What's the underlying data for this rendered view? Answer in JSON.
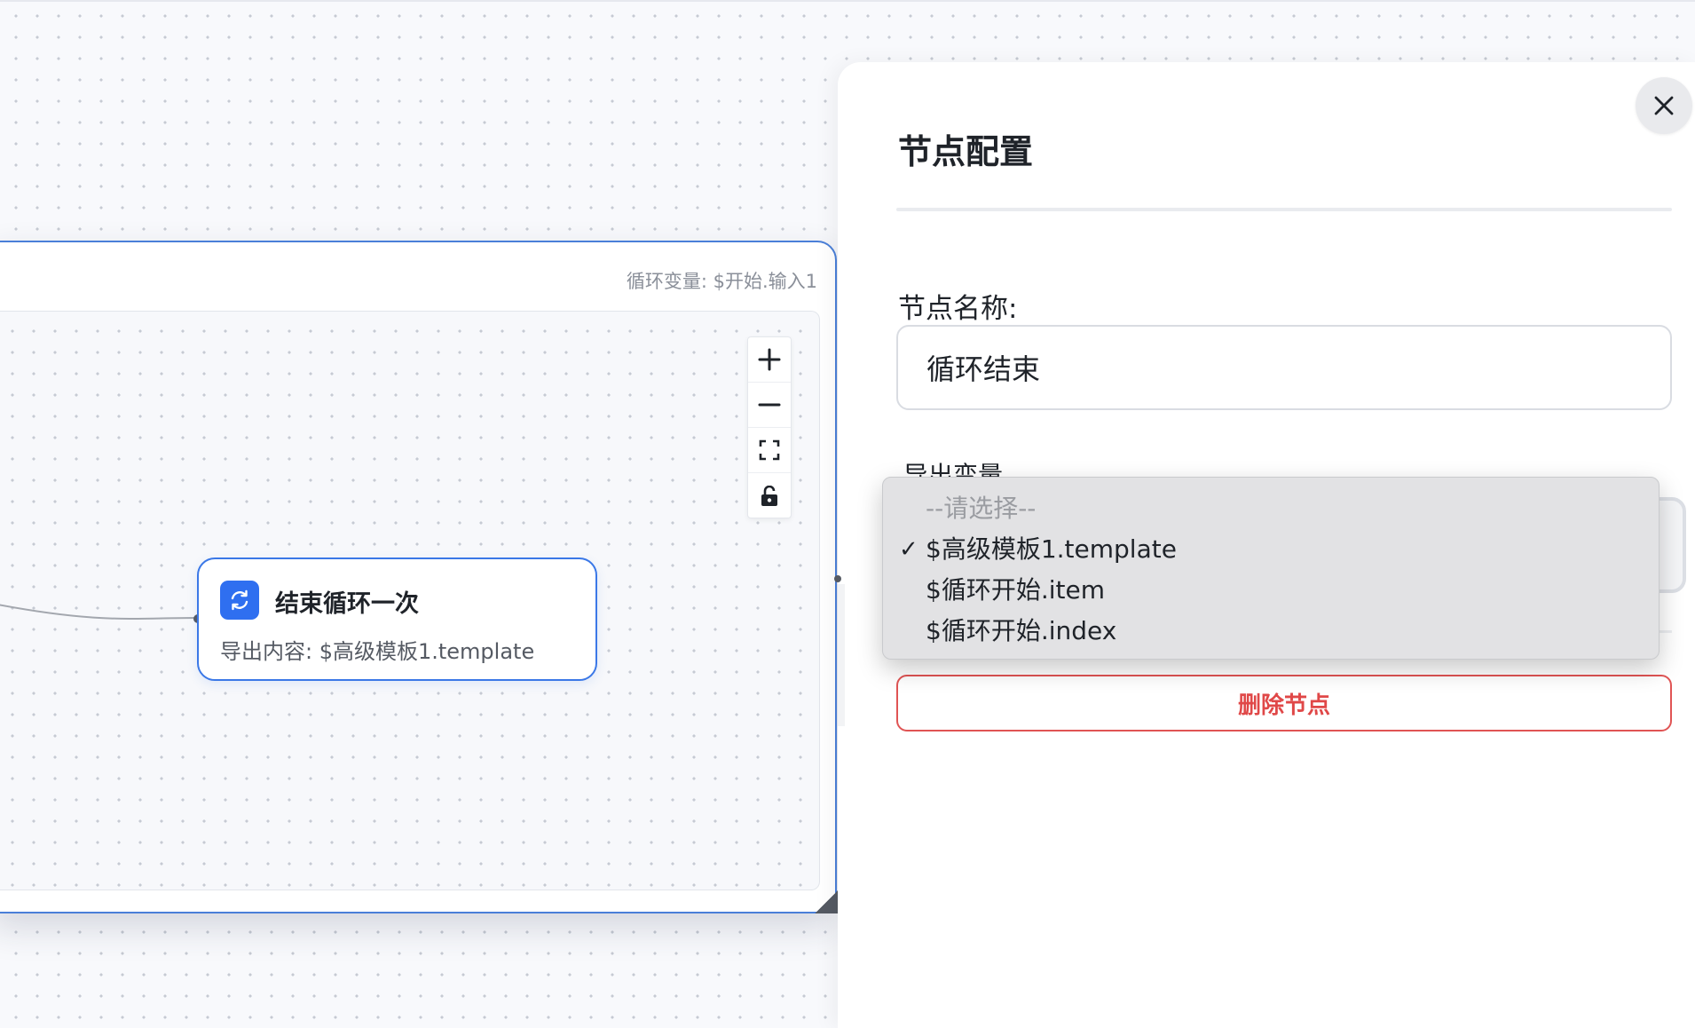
{
  "canvas": {
    "loop_group": {
      "loop_variable": "循环变量: $开始.输入1"
    },
    "node": {
      "icon": "loop-refresh-icon",
      "title": "结束循环一次",
      "description": "导出内容: $高级模板1.template"
    },
    "zoom_controls": {
      "zoom_in": "plus-icon",
      "zoom_out": "minus-icon",
      "fit_view": "fit-screen-icon",
      "lock": "unlock-icon"
    }
  },
  "panel": {
    "title": "节点配置",
    "close_icon": "close-icon",
    "name_label": "节点名称:",
    "name_value": "循环结束",
    "export_label": "导出变量",
    "export_options": [
      {
        "label": "--请选择--",
        "placeholder": true,
        "selected": false
      },
      {
        "label": "$高级模板1.template",
        "placeholder": false,
        "selected": true
      },
      {
        "label": "$循环开始.item",
        "placeholder": false,
        "selected": false
      },
      {
        "label": "$循环开始.index",
        "placeholder": false,
        "selected": false
      }
    ],
    "checkmark": "✓",
    "delete_label": "删除节点"
  },
  "colors": {
    "accent": "#3b78e7",
    "node_icon_bg": "#2f6ff0",
    "danger": "#e04848"
  }
}
